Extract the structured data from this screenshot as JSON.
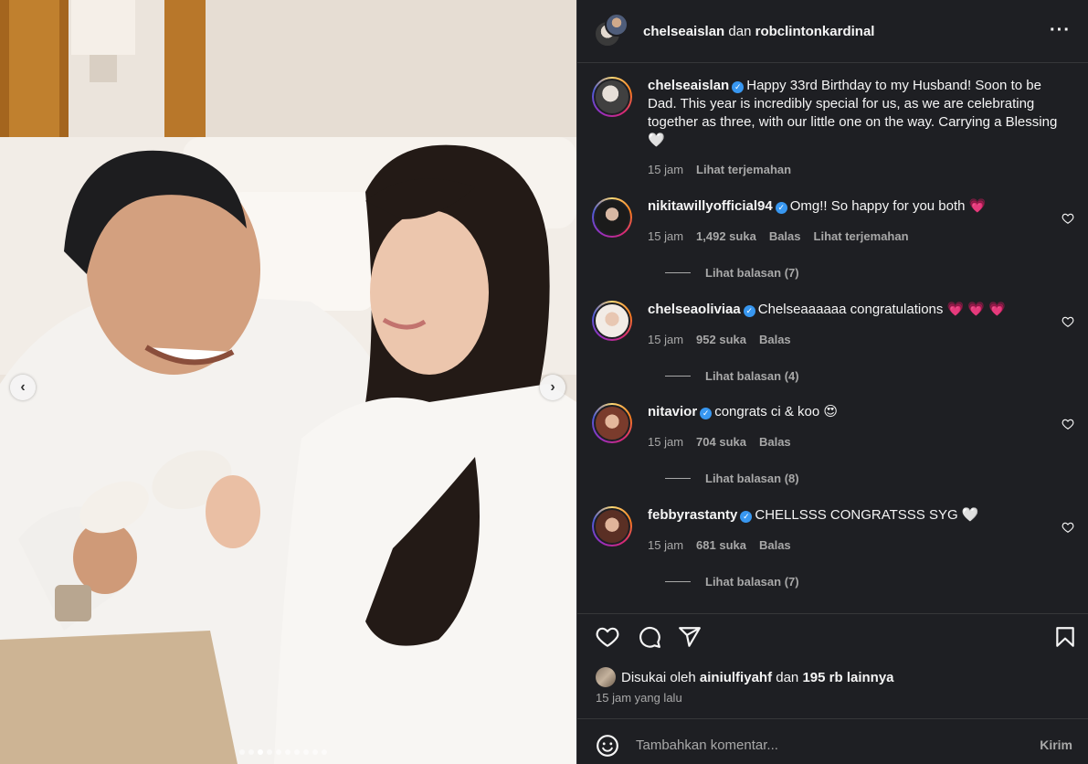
{
  "post": {
    "header": {
      "user1": "chelseaislan",
      "separator": "dan",
      "user2": "robclintonkardinal",
      "more_icon": "more-horizontal-icon"
    },
    "caption": {
      "username": "chelseaislan",
      "text": "Happy 33rd Birthday to my Husband! Soon to be Dad. This year is incredibly special for us, as we are celebrating together as three, with our little one on the way. Carrying a Blessing 🤍",
      "time": "15 jam",
      "translate": "Lihat terjemahan"
    },
    "comments": [
      {
        "username": "nikitawillyofficial94",
        "text": "Omg!! So happy for you both 💗",
        "time": "15 jam",
        "likes": "1,492 suka",
        "reply": "Balas",
        "translate": "Lihat terjemahan",
        "view_replies": "Lihat balasan (7)"
      },
      {
        "username": "chelseaoliviaa",
        "text": "Chelseaaaaaa congratulations 💗 💗 💗",
        "time": "15 jam",
        "likes": "952 suka",
        "reply": "Balas",
        "view_replies": "Lihat balasan (4)"
      },
      {
        "username": "nitavior",
        "text": "congrats ci & koo 😍",
        "time": "15 jam",
        "likes": "704 suka",
        "reply": "Balas",
        "view_replies": "Lihat balasan (8)"
      },
      {
        "username": "febbyrastanty",
        "text": "CHELLSSS CONGRATSSS SYG 🤍",
        "time": "15 jam",
        "likes": "681 suka",
        "reply": "Balas",
        "view_replies": "Lihat balasan (7)"
      }
    ],
    "actions": {
      "like_icon": "heart-icon",
      "comment_icon": "comment-icon",
      "share_icon": "send-icon",
      "save_icon": "bookmark-icon"
    },
    "likes": {
      "prefix": "Disukai oleh",
      "user": "ainiulfiyahf",
      "middle": "dan",
      "count": "195 rb lainnya"
    },
    "time_ago": "15 jam yang lalu",
    "composer": {
      "placeholder": "Tambahkan komentar...",
      "send": "Kirim",
      "emoji_icon": "emoji-icon"
    },
    "carousel": {
      "prev": "‹",
      "next": "›",
      "active_index": 3,
      "count": 10
    },
    "colors": {
      "background": "#1e1f23",
      "text": "#f5f5f5",
      "muted": "#a8a8a8",
      "verified": "#3897f0"
    }
  }
}
